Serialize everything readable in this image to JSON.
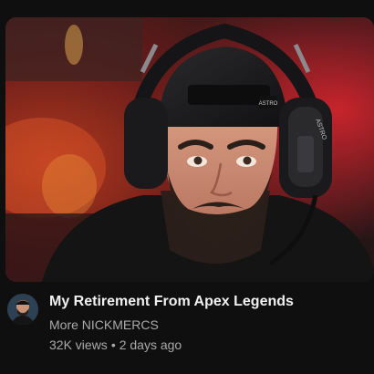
{
  "video": {
    "title": "My Retirement From Apex Legends",
    "channel": "More NICKMERCS",
    "views": "32K views",
    "separator": "•",
    "age": "2 days ago"
  },
  "thumbnail": {
    "headset_brand_text": "ASTRO"
  },
  "colors": {
    "background": "#0f0f0f",
    "title": "#f1f1f1",
    "secondary_text": "#aaaaaa"
  }
}
